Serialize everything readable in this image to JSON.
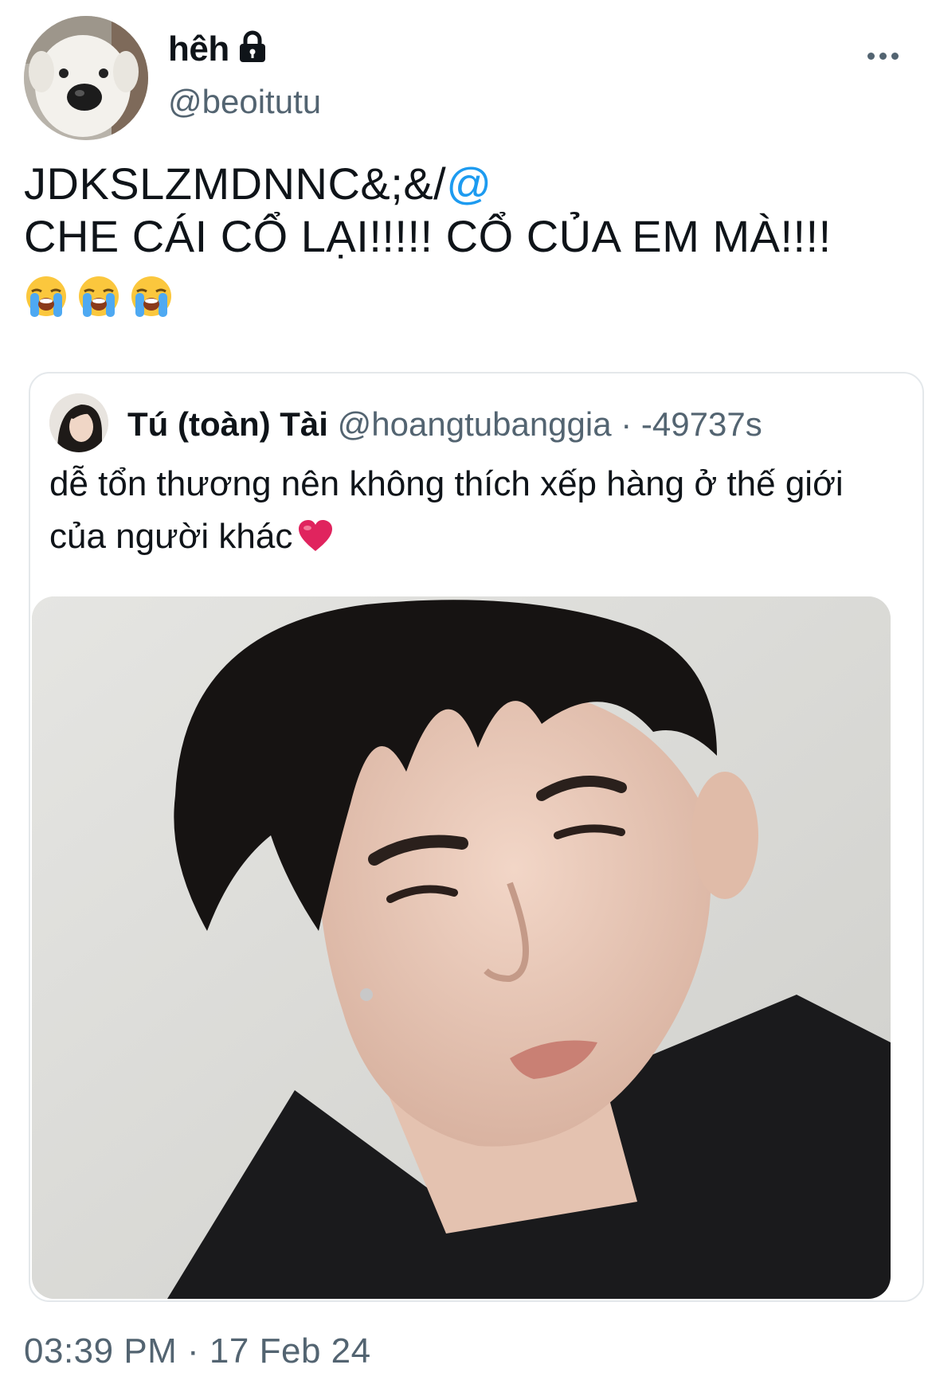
{
  "author": {
    "display_name": "hêh",
    "handle": "@beoitutu",
    "protected_icon": "lock-icon",
    "avatar_icon": "white-dog-avatar"
  },
  "tweet": {
    "line1_text": "JDKSLZMDNNC&;&/",
    "line1_mention": "@",
    "line2_text": "CHE CÁI CỔ LẠI!!!!! CỔ CỦA EM MÀ!!!!",
    "emojis": [
      "loudly-crying-face",
      "loudly-crying-face",
      "loudly-crying-face"
    ],
    "timestamp": "03:39 PM · 17 Feb 24"
  },
  "quote": {
    "display_name": "Tú (toàn) Tài",
    "handle": "@hoangtubanggia",
    "separator": "·",
    "time": "-49737s",
    "text": "dễ tổn thương nên không thích xếp hàng ở thế giới của người khác",
    "trailing_icon": "red-heart",
    "image_subject": "portrait-photo"
  },
  "colors": {
    "text_primary": "#0f1419",
    "text_secondary": "#536471",
    "link": "#1d9bf0",
    "border": "#e4e8eb",
    "heart": "#e0245e"
  }
}
